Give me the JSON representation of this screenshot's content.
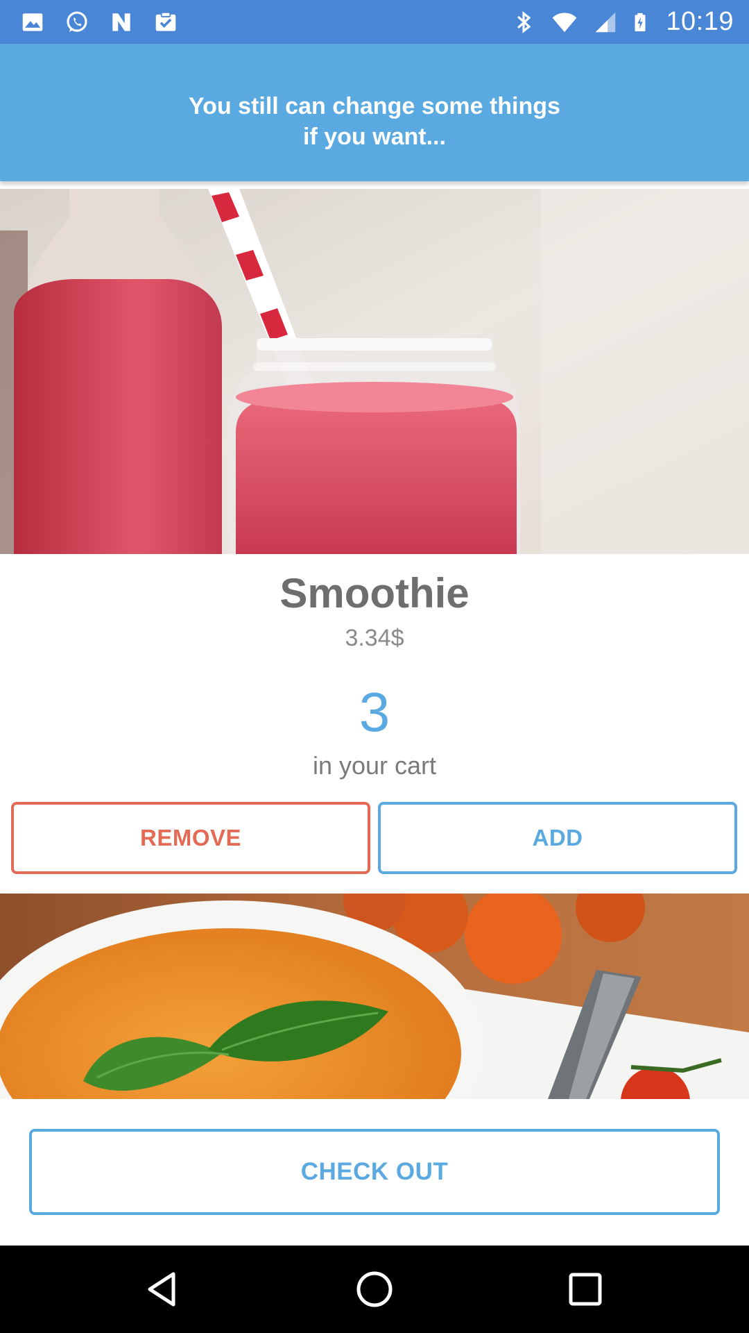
{
  "status_bar": {
    "time": "10:19",
    "left_icons": [
      "gallery-icon",
      "whatsapp-icon",
      "news-icon",
      "clipboard-check-icon"
    ],
    "right_icons": [
      "bluetooth-icon",
      "wifi-icon",
      "signal-icon",
      "battery-charging-icon"
    ]
  },
  "header": {
    "title": "You still can change some things\nif you want..."
  },
  "product": {
    "name": "Smoothie",
    "price": "3.34$",
    "quantity": "3",
    "quantity_label": "in your cart",
    "image": "smoothie-photo"
  },
  "actions": {
    "remove_label": "REMOVE",
    "add_label": "ADD",
    "checkout_label": "CHECK OUT"
  },
  "next_product": {
    "image": "tomato-soup-photo"
  },
  "nav_bar": {
    "buttons": [
      "back-icon",
      "home-icon",
      "recents-icon"
    ]
  },
  "colors": {
    "status_bar": "#4a86d6",
    "header": "#5aa9e0",
    "accent": "#5aa9e0",
    "remove": "#e36a55",
    "nav_bar": "#000000"
  }
}
